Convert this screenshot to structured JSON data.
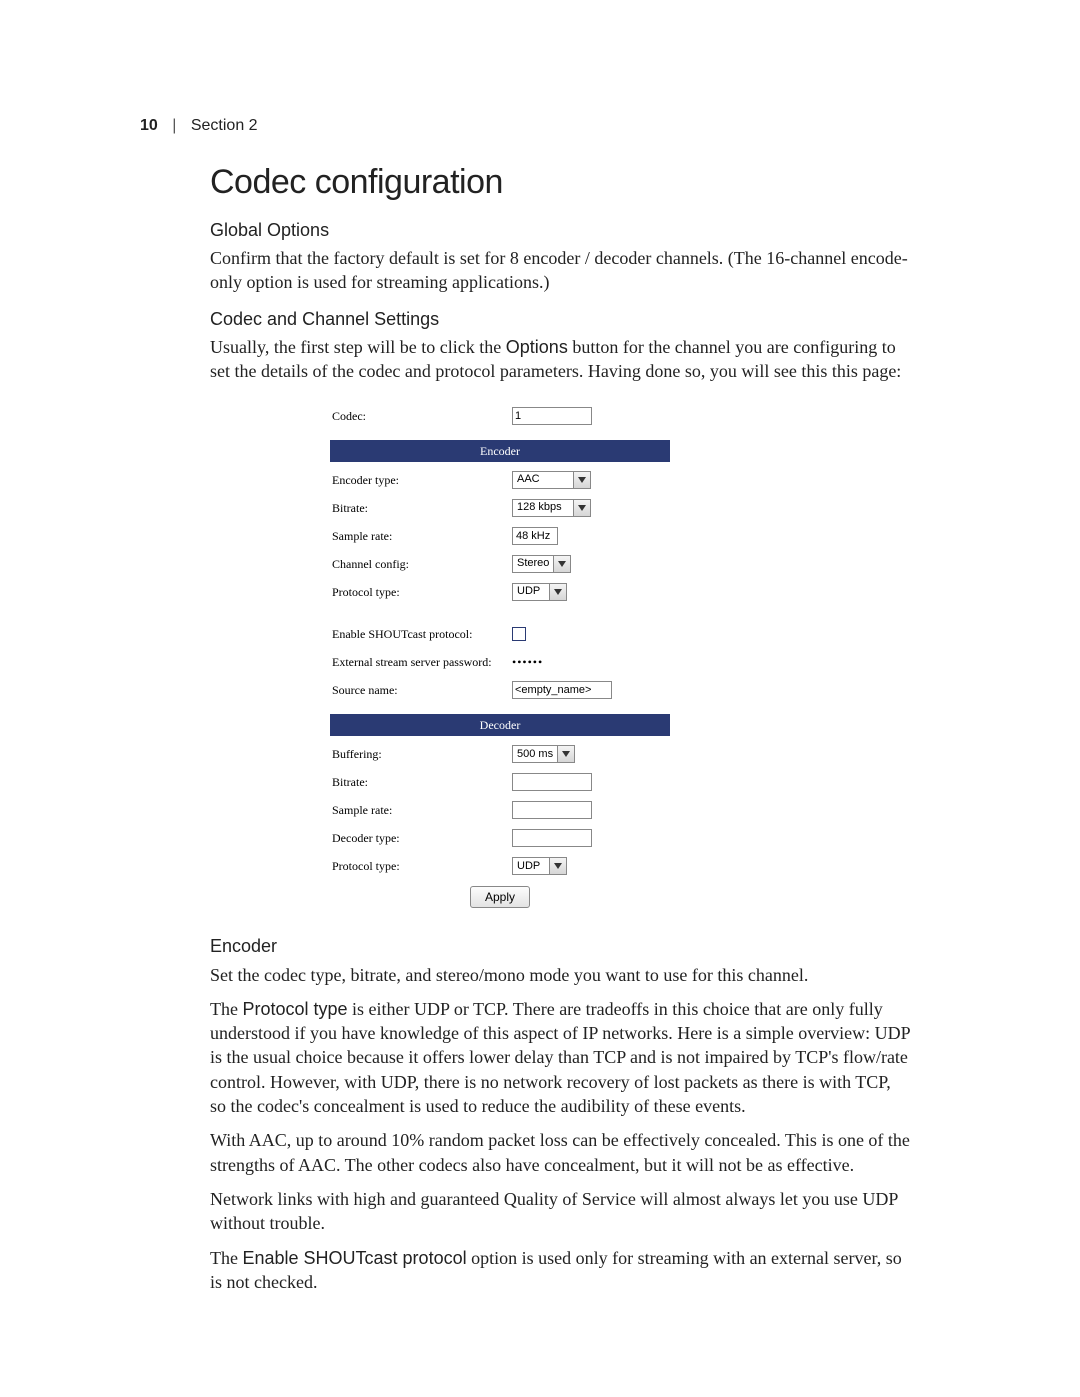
{
  "header": {
    "page_number": "10",
    "section": "Section 2"
  },
  "title": "Codec configuration",
  "sections": {
    "global_options": {
      "heading": "Global Options",
      "body": "Confirm that the factory default is set for 8 encoder / decoder channels. (The 16-channel encode-only option is used for streaming applications.)"
    },
    "codec_channel": {
      "heading": "Codec and Channel Settings",
      "lead1": "Usually, the first step will be to click the ",
      "lead_bold": "Options",
      "lead2": " button for the channel you are configuring to set the details of the codec and protocol parameters. Having done so, you will see this this page:"
    },
    "encoder_text": {
      "heading": "Encoder",
      "p1": "Set the codec type, bitrate, and stereo/mono mode you want to use for this channel.",
      "p2a": "The ",
      "p2b_bold": "Protocol type",
      "p2c": " is either UDP or TCP. There are tradeoffs in this choice that are only fully understood if you have knowledge of this aspect of IP networks. Here is a simple overview: UDP is the usual choice because it offers lower delay than TCP and is not impaired by TCP's flow/rate control. However, with UDP, there is no network recovery of lost packets as there is with TCP, so the codec's concealment is used to reduce the audibility of these events.",
      "p3": "With AAC, up to around 10% random packet loss can be effectively concealed. This is one of the strengths of AAC. The other codecs also have concealment, but it will not be as effective.",
      "p4": "Network links with high and guaranteed Quality of Service will almost always let you use UDP without trouble.",
      "p5a": "The ",
      "p5b_bold": "Enable SHOUTcast protocol",
      "p5c": " option is used only for streaming with an external server, so is not checked."
    }
  },
  "form": {
    "codec_label": "Codec:",
    "codec_value": "1",
    "encoder_band": "Encoder",
    "encoder_rows": {
      "encoder_type": {
        "label": "Encoder type:",
        "value": "AAC"
      },
      "bitrate": {
        "label": "Bitrate:",
        "value": "128 kbps"
      },
      "sample_rate": {
        "label": "Sample rate:",
        "value": "48 kHz"
      },
      "channel_cfg": {
        "label": "Channel config:",
        "value": "Stereo"
      },
      "protocol": {
        "label": "Protocol type:",
        "value": "UDP"
      },
      "shoutcast": {
        "label": "Enable SHOUTcast protocol:"
      },
      "ext_pass": {
        "label": "External stream server password:",
        "value": "••••••"
      },
      "source_name": {
        "label": "Source name:",
        "value": "<empty_name>"
      }
    },
    "decoder_band": "Decoder",
    "decoder_rows": {
      "buffering": {
        "label": "Buffering:",
        "value": "500 ms"
      },
      "bitrate": {
        "label": "Bitrate:"
      },
      "sample_rate": {
        "label": "Sample rate:"
      },
      "decoder_type": {
        "label": "Decoder type:"
      },
      "protocol": {
        "label": "Protocol type:",
        "value": "UDP"
      }
    },
    "apply": "Apply"
  }
}
